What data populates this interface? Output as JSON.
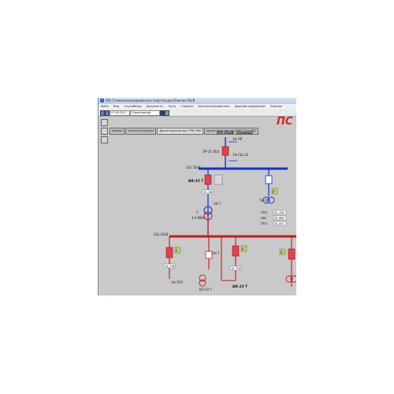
{
  "window": {
    "title": "ОІК Телемеханизированная подстанция Южная-35кВ"
  },
  "menu": [
    "Файл",
    "Вид",
    "Служебные",
    "Документы",
    "Окно",
    "Справка",
    "Автоматизированная",
    "Администрирование",
    "Помощь"
  ],
  "toolbar": {
    "date": "07.06.2017",
    "user": "Оперативный"
  },
  "tabs": [
    "Аварии",
    "Телесигнализация",
    "Диспетчерский щит РПБ ЭКФ",
    "Диспетчерский щит РПБ ЮжнаяРП"
  ],
  "diagram": {
    "station_title": "ПС",
    "line_title": "ПЛ-35кВ \"Олевіца\"",
    "line_bay": [
      "ЗН ЛР",
      "ЛР-35 ЛЕ4",
      "ЗН СШ 35"
    ],
    "bus35_label": "СШ 35кВ",
    "bus10_label": "СШ 10кВ",
    "breaker_top_label": "ВВ-35 Т",
    "breaker_bottom_label": "ВВ-10 Т",
    "transformer_label": "Т",
    "transformer_rating": "4,0 МВА",
    "tn_label": "ТН-35",
    "zn_label": "ЗН Т",
    "readouts": [
      {
        "name": "Uла",
        "value": "35,756"
      },
      {
        "name": "Uвс",
        "value": "35,088"
      },
      {
        "name": "Uса",
        "value": "35,031"
      }
    ],
    "bay_values": [
      "35,186",
      "10,718",
      "10,728"
    ],
    "small_labels": [
      "ЗН ТРП",
      "ЗН Т",
      "ВЛ-10 Т"
    ],
    "status_boxes": [
      "Р",
      "Р",
      "Р",
      "Р"
    ]
  },
  "colors": {
    "bus_blue": "#1230d8",
    "bus_red": "#c81818",
    "breaker_red": "#e8404a",
    "accent_green": "#b6d66a"
  }
}
